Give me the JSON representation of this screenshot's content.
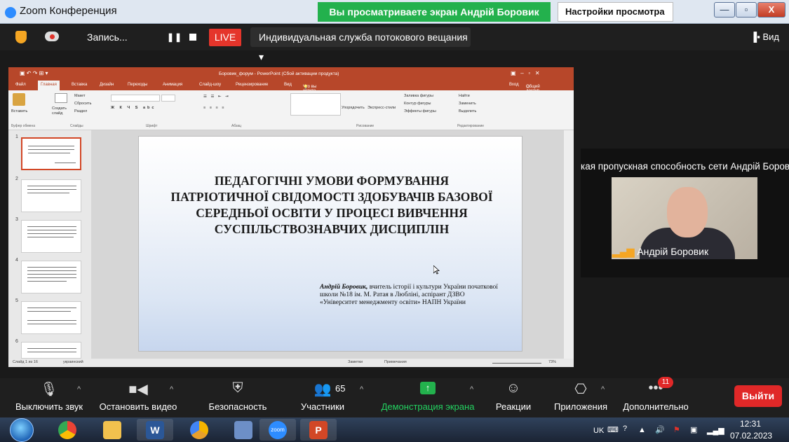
{
  "window": {
    "title": "Zoom Конференция",
    "share_banner": "Вы просматриваете экран Андрій Боровик",
    "view_settings": "Настройки просмотра ⌄",
    "min": "—",
    "max": "▫",
    "close": "X"
  },
  "zoom_top": {
    "recording": "Запись...",
    "pause": "❚❚",
    "live": "LIVE",
    "stream_service": "Индивидуальная служба потокового вещания ▾",
    "view": "Вид"
  },
  "ppt": {
    "title": "Боровик_форум - PowerPoint (Сбой активации продукта)",
    "tabs": [
      "Файл",
      "Главная",
      "Вставка",
      "Дизайн",
      "Переходы",
      "Анимация",
      "Слайд-шоу",
      "Рецензирование",
      "Вид",
      "Что вы хотите сделать?"
    ],
    "tab_right": [
      "Вход",
      "Общий доступ"
    ],
    "ribbon_groups": [
      "Буфер обмена",
      "Слайды",
      "Шрифт",
      "Абзац",
      "Рисование",
      "Редактирование"
    ],
    "ribbon_items": {
      "paste": "Вставить",
      "new_slide": "Создать слайд",
      "layout": "Макет",
      "reset": "Сбросить",
      "section": "Раздел",
      "arrange": "Упорядочить",
      "styles": "Экспресс-стили",
      "fill": "Заливка фигуры",
      "outline": "Контур фигуры",
      "effects": "Эффекты фигуры",
      "find": "Найти",
      "replace": "Заменить",
      "select": "Выделить"
    },
    "thumb_numbers": [
      "1",
      "2",
      "3",
      "4",
      "5",
      "6"
    ],
    "slide_title": "ПЕДАГОГІЧНІ УМОВИ ФОРМУВАННЯ ПАТРІОТИЧНОЇ СВІДОМОСТІ ЗДОБУВАЧІВ БАЗОВОЇ СЕРЕДНЬОЇ ОСВІТИ У ПРОЦЕСІ ВИВЧЕННЯ СУСПІЛЬСТВОЗНАВЧИХ ДИСЦИПЛІН",
    "author_name": "Андрій Боровик,",
    "author_rest": " вчитель історії і культури України початкової школи №18 ім. М. Ратая в Любліні, аспірант ДЗВО «Університет менеджменту освіти» НАПН України",
    "status_left": "Слайд 1 из 16",
    "status_lang": "украинский",
    "notes": "Заметки",
    "comments": "Примечания",
    "zoom": "73%"
  },
  "video": {
    "label": "кая пропускная способность сети Андрій Боровик",
    "name": "Андрій Боровик",
    "signal": "▂▄▆"
  },
  "toolbar": [
    {
      "label": "Выключить звук",
      "icon": "🎙"
    },
    {
      "label": "Остановить видео",
      "icon": "■◀"
    },
    {
      "label": "Безопасность",
      "icon": "⛨"
    },
    {
      "label": "Участники",
      "icon": "👥",
      "count": "65"
    },
    {
      "label": "Демонстрация экрана",
      "icon": "↑"
    },
    {
      "label": "Реакции",
      "icon": "☺"
    },
    {
      "label": "Приложения",
      "icon": "⎔"
    },
    {
      "label": "Дополнительно",
      "icon": "•••",
      "badge": "11"
    }
  ],
  "leave": "Выйти",
  "taskbar": {
    "lang": "UK",
    "time": "12:31",
    "date": "07.02.2023",
    "apps": [
      "chrome",
      "explorer",
      "word",
      "chrome-canary",
      "tool",
      "zoom",
      "powerpoint"
    ],
    "zoom_label": "zoom"
  }
}
